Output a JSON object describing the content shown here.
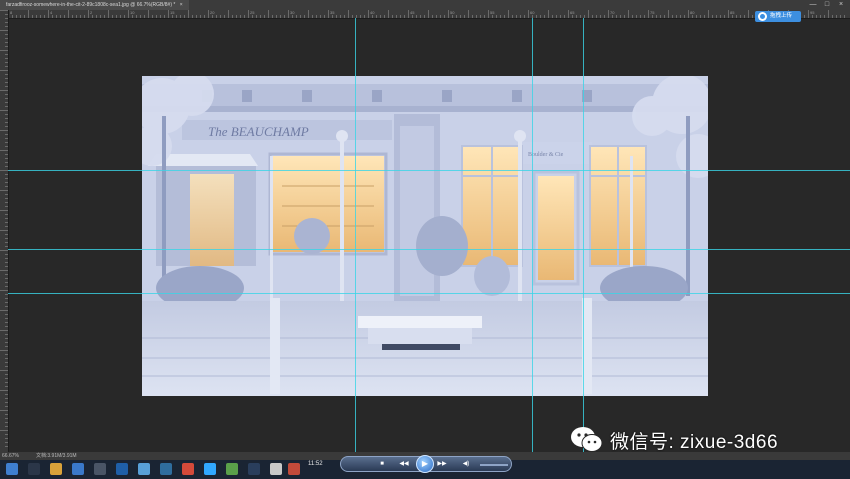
{
  "document": {
    "tab_title": "farzadfirooz-somewhere-in-the-cit-2-89c1808c-sea1.jpg @ 66.7%(RGB/8#) *",
    "close_glyph": "×"
  },
  "window_controls": [
    "—",
    "□",
    "×"
  ],
  "ruler_top_labels": [
    "8",
    "4",
    "2",
    "10",
    "15",
    "20",
    "25",
    "30",
    "35",
    "40",
    "45",
    "50",
    "55",
    "60",
    "65",
    "70",
    "75",
    "80",
    "85",
    "90",
    "95"
  ],
  "upload_button": {
    "label": "拖拽上传",
    "color": "#3d8fe0"
  },
  "canvas_scene": {
    "storefront_sign": "The BEAUCHAMP",
    "window_sign": "Boulder & Cie",
    "palette": {
      "stone": "#c9d1e8",
      "shadow": "#8f9cc0",
      "warm": "#f2c98a",
      "glow": "#ffe8c0"
    }
  },
  "status_bar": {
    "zoom": "66.67%",
    "doc_info": "文档:3.91M/3.91M"
  },
  "taskbar": {
    "clock": "11:52",
    "media_buttons": {
      "stop": "■",
      "prev": "◀◀",
      "play": "▶",
      "next": "▶▶",
      "volume": "◀)"
    }
  },
  "watermark": {
    "text": "微信号: zixue-3d66"
  },
  "guides": {
    "color": "#39d5e6"
  }
}
